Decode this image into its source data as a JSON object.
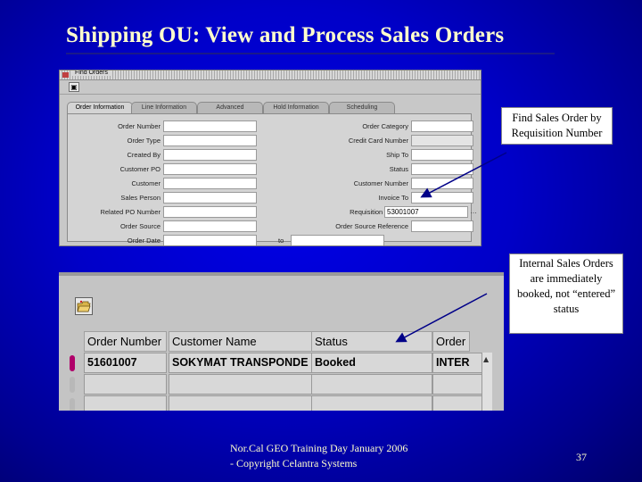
{
  "slide": {
    "title": "Shipping OU: View and Process Sales Orders",
    "footer": "Nor.Cal GEO Training Day January 2006 - Copyright Celantra Systems",
    "page_number": "37"
  },
  "find_window": {
    "title": "Find Orders",
    "tabs": [
      "Order Information",
      "Line Information",
      "Advanced",
      "Hold Information",
      "Scheduling"
    ],
    "left_fields": [
      {
        "label": "Order Number",
        "value": ""
      },
      {
        "label": "Order Type",
        "value": ""
      },
      {
        "label": "Created By",
        "value": ""
      },
      {
        "label": "Customer PO",
        "value": ""
      },
      {
        "label": "Customer",
        "value": ""
      },
      {
        "label": "Sales Person",
        "value": ""
      },
      {
        "label": "Related PO Number",
        "value": ""
      },
      {
        "label": "Order Source",
        "value": ""
      },
      {
        "label": "Order Date",
        "value": ""
      }
    ],
    "right_fields": [
      {
        "label": "Order Category",
        "value": ""
      },
      {
        "label": "Credit Card Number",
        "value": ""
      },
      {
        "label": "Ship To",
        "value": ""
      },
      {
        "label": "Status",
        "value": ""
      },
      {
        "label": "Customer Number",
        "value": ""
      },
      {
        "label": "Invoice To",
        "value": ""
      },
      {
        "label": "Requisition Number",
        "value": "53001007"
      },
      {
        "label": "Order Source Reference",
        "value": ""
      }
    ],
    "order_date_separator": "to"
  },
  "callouts": {
    "find": "Find Sales Order by Requisition Number",
    "internal": "Internal Sales Orders are immediately booked, not “entered” status"
  },
  "orders_table": {
    "columns": [
      "Order Number",
      "Customer Name",
      "Status",
      "Order"
    ],
    "rows": [
      {
        "order_number": "51601007",
        "customer_name": "SOKYMAT TRANSPONDE",
        "status": "Booked",
        "order": "INTER"
      },
      {
        "order_number": "",
        "customer_name": "",
        "status": "",
        "order": ""
      },
      {
        "order_number": "",
        "customer_name": "",
        "status": "",
        "order": ""
      }
    ]
  },
  "colors": {
    "slide_background": "#0000c8",
    "title_text": "#ffffcc",
    "selected_row_marker": "#b0006a",
    "arrow": "#000088"
  }
}
